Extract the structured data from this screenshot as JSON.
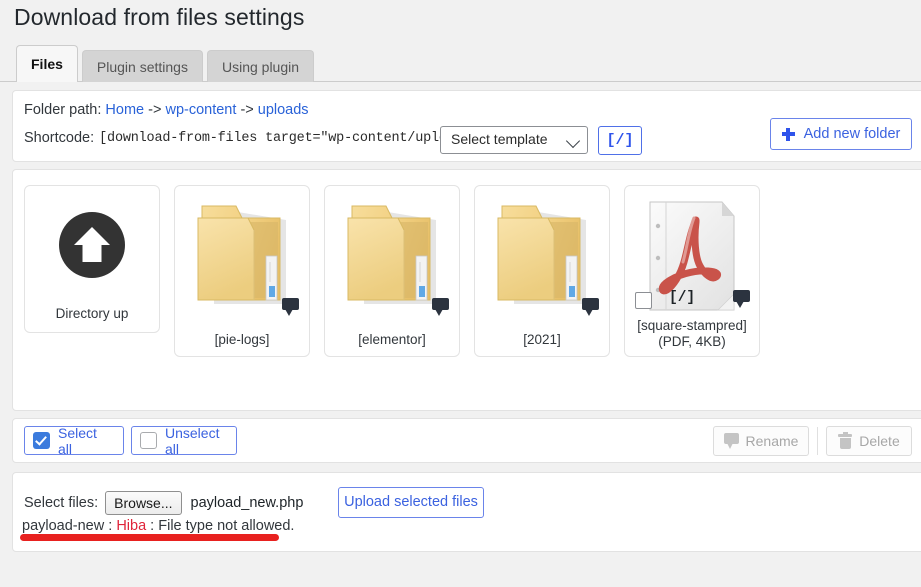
{
  "page": {
    "title": "Download from files settings"
  },
  "tabs": [
    {
      "label": "Files",
      "active": true
    },
    {
      "label": "Plugin settings",
      "active": false
    },
    {
      "label": "Using plugin",
      "active": false
    }
  ],
  "path_row": {
    "label": "Folder path:",
    "crumbs": [
      "Home",
      "wp-content",
      "uploads"
    ],
    "separator": "->"
  },
  "shortcode_row": {
    "label": "Shortcode:",
    "code": "[download-from-files target=\"wp-content/uploads\"]",
    "template_select": {
      "value": "Select template",
      "options": [
        "Select template"
      ],
      "icon": "chevron-down-icon"
    },
    "code_button": {
      "label": "[/]",
      "icon": "code-icon"
    }
  },
  "add_new_folder_button": {
    "label": "Add new folder",
    "icon": "plus-icon"
  },
  "tiles": [
    {
      "kind": "directory-up",
      "icon": "arrow-up-circle-icon",
      "caption": "Directory up"
    },
    {
      "kind": "folder",
      "icon": "folder-icon",
      "caption": "[pie-logs]",
      "bubble_icon": "comment-bubble-icon"
    },
    {
      "kind": "folder",
      "icon": "folder-icon",
      "caption": "[elementor]",
      "bubble_icon": "comment-bubble-icon"
    },
    {
      "kind": "folder",
      "icon": "folder-icon",
      "caption": "[2021]",
      "bubble_icon": "comment-bubble-icon"
    },
    {
      "kind": "file",
      "icon": "pdf-file-icon",
      "code_label": "[/]",
      "caption": "[square-stampred]",
      "meta": "(PDF, 4KB)",
      "checked": false,
      "bubble_icon": "comment-bubble-icon"
    }
  ],
  "selection_bar": {
    "select_all": {
      "label": "Select all",
      "checked": true
    },
    "unselect_all": {
      "label": "Unselect all",
      "checked": false
    },
    "rename": {
      "label": "Rename",
      "icon": "comment-bubble-icon",
      "disabled": true
    },
    "delete": {
      "label": "Delete",
      "icon": "trash-icon",
      "disabled": true
    }
  },
  "upload": {
    "select_files_label": "Select files:",
    "browse_button": "Browse...",
    "chosen_file": "payload_new.php",
    "upload_button": "Upload selected files",
    "error": {
      "file": "payload-new",
      "sep1": " : ",
      "keyword": "Hiba",
      "sep2": " : ",
      "message": "File type not allowed."
    }
  },
  "colors": {
    "accent_blue": "#3b62e0",
    "link_blue": "#2962d8",
    "error_red": "#e0243a",
    "annotation_red": "#e8211f",
    "folder_yellow": "#f5d98a",
    "pdf_red": "#c9534a"
  }
}
